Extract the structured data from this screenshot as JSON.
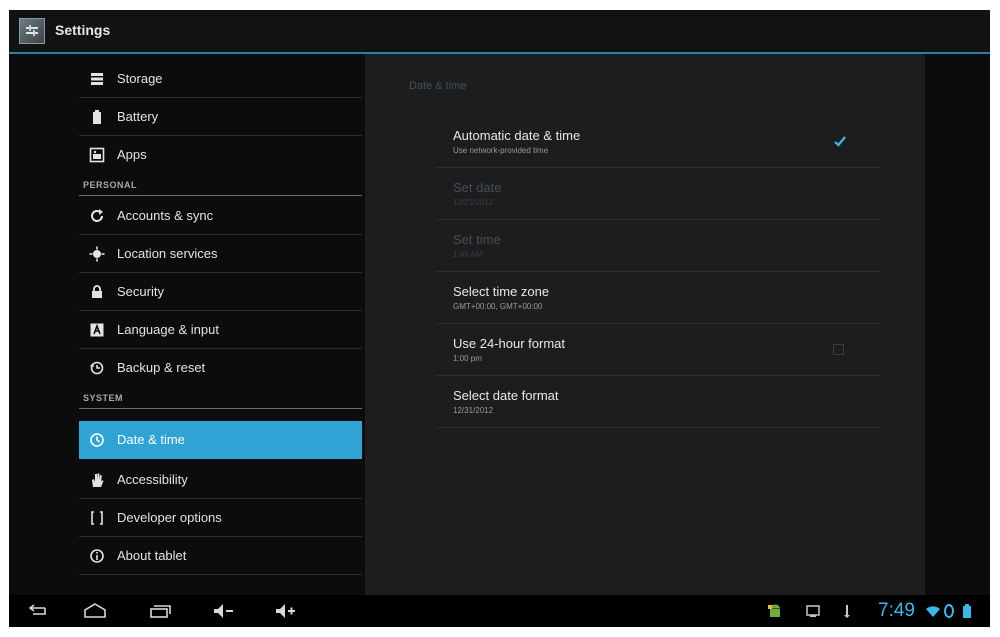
{
  "app": {
    "title": "Settings"
  },
  "sidebar": {
    "items": [
      {
        "label": "Storage",
        "icon": "storage-icon"
      },
      {
        "label": "Battery",
        "icon": "battery-icon"
      },
      {
        "label": "Apps",
        "icon": "apps-icon"
      }
    ],
    "personal_header": "PERSONAL",
    "personal_items": [
      {
        "label": "Accounts & sync",
        "icon": "sync-icon"
      },
      {
        "label": "Location services",
        "icon": "location-icon"
      },
      {
        "label": "Security",
        "icon": "lock-icon"
      },
      {
        "label": "Language & input",
        "icon": "keyboard-icon"
      },
      {
        "label": "Backup & reset",
        "icon": "backup-icon"
      }
    ],
    "system_header": "SYSTEM",
    "system_items": [
      {
        "label": "Date & time",
        "icon": "clock-icon",
        "selected": true
      },
      {
        "label": "Accessibility",
        "icon": "hand-icon"
      },
      {
        "label": "Developer options",
        "icon": "braces-icon"
      },
      {
        "label": "About tablet",
        "icon": "info-icon"
      }
    ]
  },
  "detail": {
    "title": "Date & time",
    "prefs": [
      {
        "title": "Automatic date & time",
        "summary": "Use network-provided time",
        "checked": true
      },
      {
        "title": "Set date",
        "summary": "12/21/2012",
        "disabled": true
      },
      {
        "title": "Set time",
        "summary": "1:49 AM",
        "disabled": true
      },
      {
        "title": "Select time zone",
        "summary": "GMT+00:00, GMT+00:00"
      },
      {
        "title": "Use 24-hour format",
        "summary": "1:00 pm",
        "checked": false
      },
      {
        "title": "Select date format",
        "summary": "12/31/2012"
      }
    ]
  },
  "systembar": {
    "clock": "7:49",
    "accent": "#3ab8ec"
  },
  "colors": {
    "selected": "#2fa3d4",
    "accent_line": "#2f7f9e"
  }
}
